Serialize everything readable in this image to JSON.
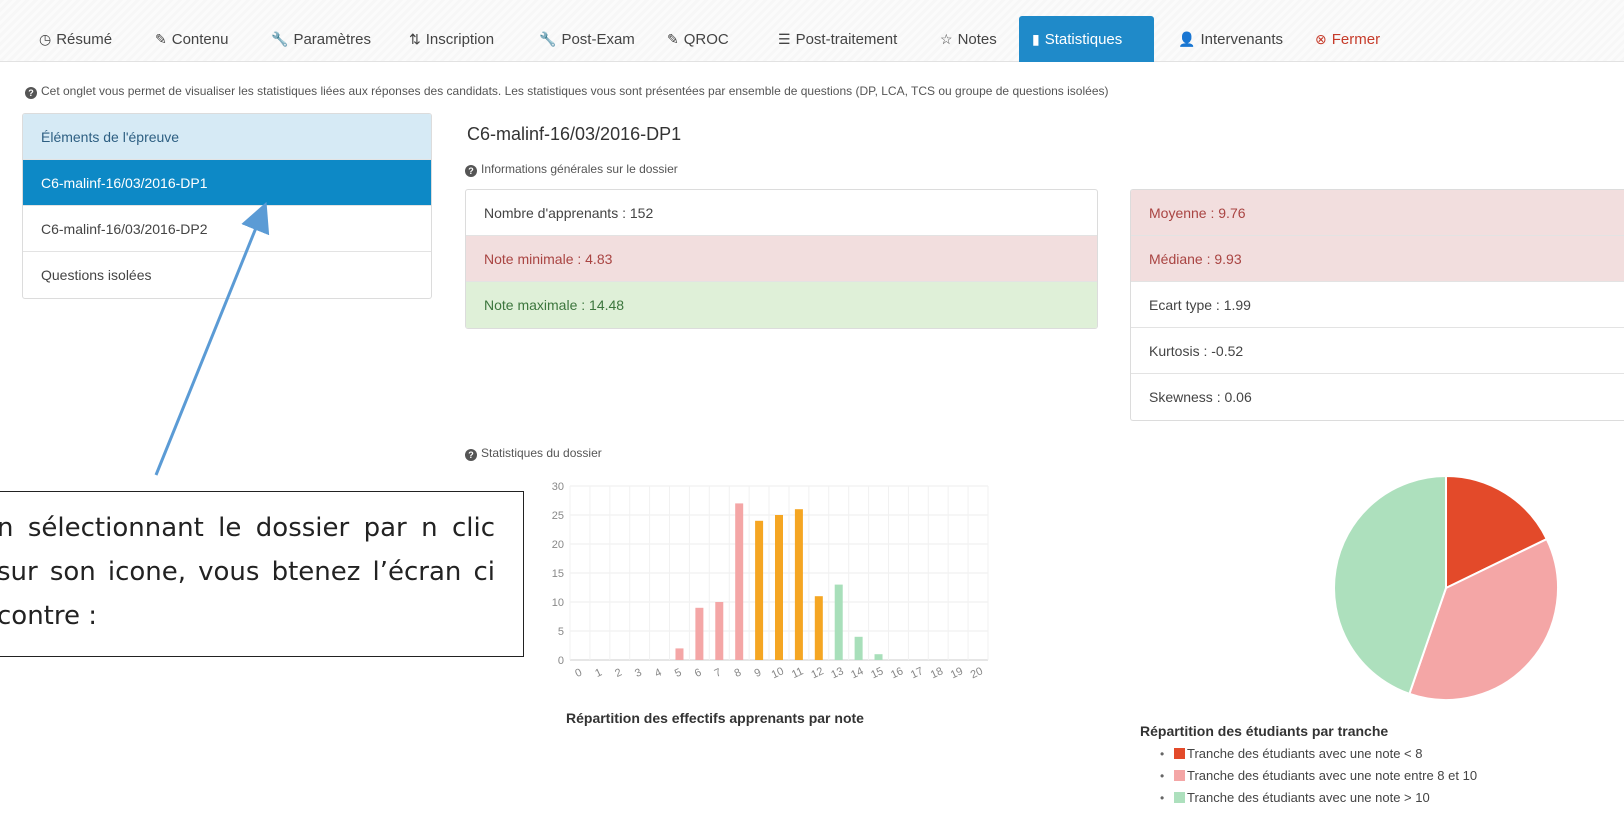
{
  "tabs": [
    {
      "icon": "◷",
      "label": "Résumé"
    },
    {
      "icon": "✎",
      "label": "Contenu"
    },
    {
      "icon": "🔧",
      "label": "Paramètres"
    },
    {
      "icon": "⇅",
      "label": "Inscription"
    },
    {
      "icon": "🔧",
      "label": "Post-Exam"
    },
    {
      "icon": "✎",
      "label": "QROC"
    },
    {
      "icon": "☰",
      "label": "Post-traitement"
    },
    {
      "icon": "☆",
      "label": "Notes"
    },
    {
      "icon": "▮",
      "label": "Statistiques"
    },
    {
      "icon": "👤",
      "label": "Intervenants"
    },
    {
      "icon": "⊗",
      "label": "Fermer"
    }
  ],
  "info_text": "Cet onglet vous permet de visualiser les statistiques liées aux réponses des candidats. Les statistiques vous sont présentées par ensemble de questions (DP, LCA, TCS ou groupe de questions isolées)",
  "sidebar": {
    "header": "Éléments de l'épreuve",
    "items": [
      "C6-malinf-16/03/2016-DP1",
      "C6-malinf-16/03/2016-DP2",
      "Questions isolées"
    ]
  },
  "dossier": {
    "title": "C6-malinf-16/03/2016-DP1",
    "subtitle": "Informations générales sur le dossier",
    "learners": "Nombre d'apprenants : 152",
    "min_note": "Note minimale : 4.83",
    "max_note": "Note maximale : 14.48",
    "mean": "Moyenne : 9.76",
    "median": "Médiane : 9.93",
    "stddev": "Ecart type : 1.99",
    "kurtosis": "Kurtosis : -0.52",
    "skewness": "Skewness : 0.06"
  },
  "stats_label": "Statistiques du dossier",
  "chart_data": [
    {
      "type": "bar",
      "title": "Répartition des effectifs apprenants par note",
      "categories": [
        "0",
        "1",
        "2",
        "3",
        "4",
        "5",
        "6",
        "7",
        "8",
        "9",
        "10",
        "11",
        "12",
        "13",
        "14",
        "15",
        "16",
        "17",
        "18",
        "19",
        "20"
      ],
      "values": [
        0,
        0,
        0,
        0,
        0,
        2,
        9,
        10,
        27,
        24,
        25,
        26,
        11,
        13,
        4,
        1,
        0,
        0,
        0,
        0,
        0
      ],
      "bar_colors": [
        "#f4a6a6",
        "#f4a6a6",
        "#f4a6a6",
        "#f4a6a6",
        "#f4a6a6",
        "#f4a6a6",
        "#f4a6a6",
        "#f4a6a6",
        "#f4a6a6",
        "#f5a623",
        "#f5a623",
        "#f5a623",
        "#f5a623",
        "#a8dfba",
        "#a8dfba",
        "#a8dfba",
        "#a8dfba",
        "#a8dfba",
        "#a8dfba",
        "#a8dfba",
        "#a8dfba"
      ],
      "yticks": [
        0,
        5,
        10,
        15,
        20,
        25,
        30
      ],
      "ylim": [
        0,
        30
      ]
    },
    {
      "type": "pie",
      "title": "Répartition des étudiants par tranche",
      "labels": [
        "Tranche des étudiants avec une note < 8",
        "Tranche des étudiants avec une note entre 8 et 10",
        "Tranche des étudiants avec une note > 10"
      ],
      "values": [
        17.8,
        37.5,
        44.7
      ],
      "colors": [
        "#e34a2a",
        "#f4a6a6",
        "#ade0bd"
      ]
    }
  ],
  "callout_text": "n sélectionnant le dossier par n clic sur son icone, vous btenez l’écran ci contre :"
}
